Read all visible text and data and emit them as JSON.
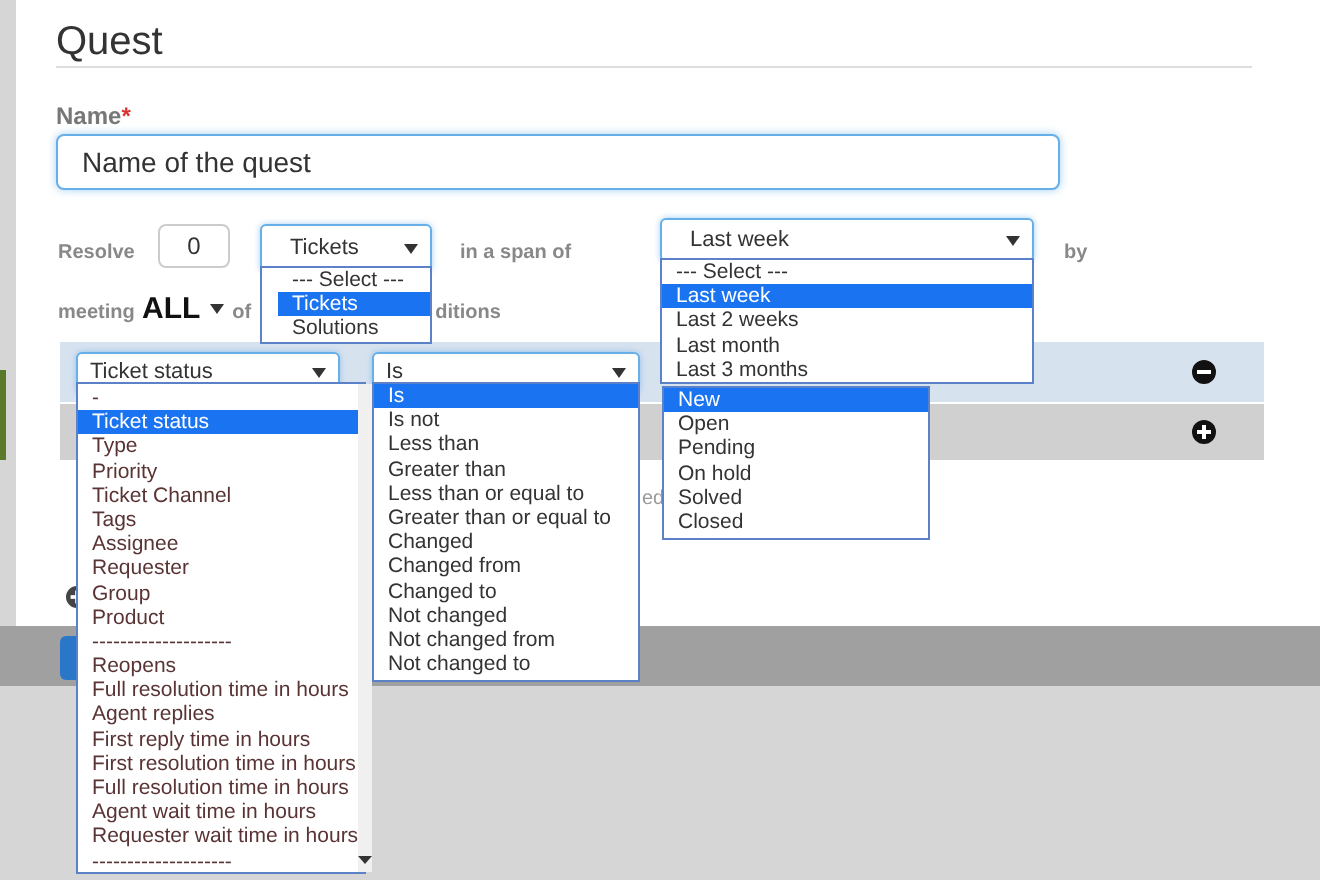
{
  "page": {
    "title": "Quest"
  },
  "name_field": {
    "label": "Name",
    "required_mark": "*",
    "value": "Name of the quest"
  },
  "goal": {
    "resolve_label": "Resolve",
    "count": "0",
    "object_select": {
      "value": "Tickets",
      "expanded": true,
      "options": [
        {
          "label": "--- Select ---",
          "selected": false
        },
        {
          "label": "Tickets",
          "selected": true
        },
        {
          "label": "Solutions",
          "selected": false
        }
      ]
    },
    "span_label": "in a span of",
    "span_select": {
      "value": "Last week",
      "expanded": true,
      "options": [
        {
          "label": "--- Select ---",
          "selected": false
        },
        {
          "label": "Last week",
          "selected": true
        },
        {
          "label": "Last 2 weeks",
          "selected": false
        },
        {
          "label": "Last month",
          "selected": false
        },
        {
          "label": "Last 3 months",
          "selected": false
        }
      ]
    },
    "by_label": "by"
  },
  "match": {
    "label": "meeting",
    "mode": "ALL",
    "of_label": "of",
    "tail": "ditions"
  },
  "conditions": [
    {
      "removable": true,
      "field_select": {
        "value": "Ticket status",
        "expanded": true,
        "options": [
          {
            "label": "-",
            "selected": false
          },
          {
            "label": "Ticket status",
            "selected": true
          },
          {
            "label": "Type",
            "selected": false
          },
          {
            "label": "Priority",
            "selected": false
          },
          {
            "label": "Ticket Channel",
            "selected": false
          },
          {
            "label": "Tags",
            "selected": false
          },
          {
            "label": "Assignee",
            "selected": false
          },
          {
            "label": "Requester",
            "selected": false
          },
          {
            "label": "Group",
            "selected": false
          },
          {
            "label": "Product",
            "selected": false
          },
          {
            "label": "--------------------",
            "selected": false
          },
          {
            "label": "Reopens",
            "selected": false
          },
          {
            "label": "Full resolution time in hours",
            "selected": false
          },
          {
            "label": "Agent replies",
            "selected": false
          },
          {
            "label": "First reply time in hours",
            "selected": false
          },
          {
            "label": "First resolution time in hours",
            "selected": false
          },
          {
            "label": "Full resolution time in hours",
            "selected": false
          },
          {
            "label": "Agent wait time in hours",
            "selected": false
          },
          {
            "label": "Requester wait time in hours",
            "selected": false
          },
          {
            "label": "--------------------",
            "selected": false
          }
        ]
      },
      "operator_select": {
        "value": "Is",
        "expanded": true,
        "options": [
          {
            "label": "Is",
            "selected": true
          },
          {
            "label": "Is not",
            "selected": false
          },
          {
            "label": "Less than",
            "selected": false
          },
          {
            "label": "Greater than",
            "selected": false
          },
          {
            "label": "Less than or equal to",
            "selected": false
          },
          {
            "label": "Greater than or equal to",
            "selected": false
          },
          {
            "label": "Changed",
            "selected": false
          },
          {
            "label": "Changed from",
            "selected": false
          },
          {
            "label": "Changed to",
            "selected": false
          },
          {
            "label": "Not changed",
            "selected": false
          },
          {
            "label": "Not changed from",
            "selected": false
          },
          {
            "label": "Not changed to",
            "selected": false
          }
        ]
      },
      "value_list": {
        "options": [
          {
            "label": "New",
            "selected": true
          },
          {
            "label": "Open",
            "selected": false
          },
          {
            "label": "Pending",
            "selected": false
          },
          {
            "label": "On hold",
            "selected": false
          },
          {
            "label": "Solved",
            "selected": false
          },
          {
            "label": "Closed",
            "selected": false
          }
        ]
      }
    },
    {
      "removable": false
    }
  ],
  "hint_fragment": "ed"
}
